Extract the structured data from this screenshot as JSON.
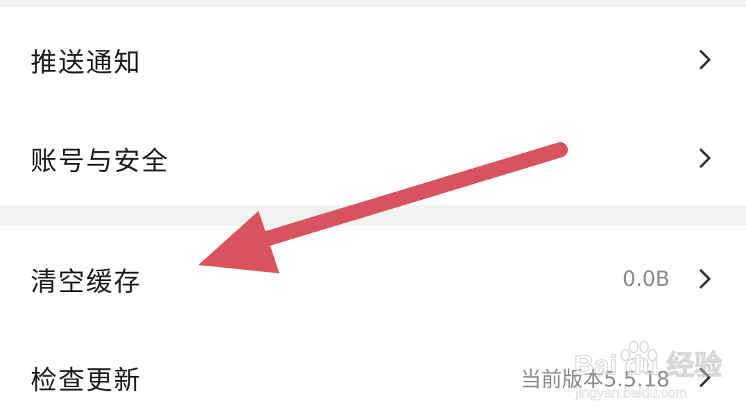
{
  "settings": {
    "items": [
      {
        "label": "推送通知",
        "value": ""
      },
      {
        "label": "账号与安全",
        "value": ""
      },
      {
        "label": "清空缓存",
        "value": "0.0B"
      },
      {
        "label": "检查更新",
        "value": "当前版本5.5.18"
      }
    ]
  },
  "annotation": {
    "arrow_color": "#d9535f",
    "target": "清空缓存"
  },
  "watermark": {
    "main": "Bai du 经验",
    "sub": "jingyan.baidu.com"
  },
  "icons": {
    "row_chevron": "chevron-right-icon",
    "watermark_logo": "paw-icon"
  }
}
